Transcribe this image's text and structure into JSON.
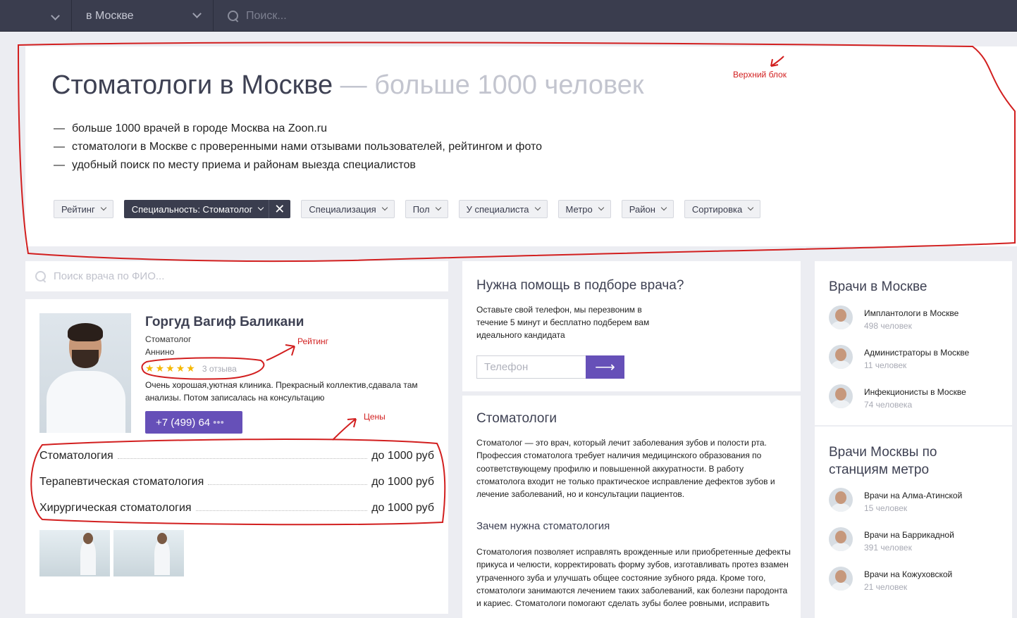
{
  "topnav": {
    "city": "в Москве",
    "search_placeholder": "Поиск..."
  },
  "topblock": {
    "title": "Стоматологи в Москве",
    "title_sub": " — больше 1000 человек",
    "bullets": [
      "больше 1000 врачей в городе Москва на Zoon.ru",
      "стоматологи в Москве с проверенными нами отзывами пользователей, рейтингом и фото",
      "удобный поиск по месту приема и районам выезда специалистов"
    ],
    "filters": [
      "Рейтинг",
      "Специальность: Стоматолог",
      "Специализация",
      "Пол",
      "У специалиста",
      "Метро",
      "Район",
      "Сортировка"
    ]
  },
  "doctor_search": {
    "placeholder": "Поиск врача по ФИО..."
  },
  "doctor": {
    "name": "Горгуд Вагиф Баликани",
    "specialty": "Стоматолог",
    "location": "Аннино",
    "rating_stars": 5,
    "reviews": "3 отзыва",
    "review_text": "Очень хорошая,уютная клиника. Прекрасный коллектив,сдавала там анализы. Потом записалась на консультацию",
    "phone": "+7 (499) 64",
    "phone_more": "•••",
    "prices": [
      {
        "service": "Стоматология",
        "price": "до 1000 руб"
      },
      {
        "service": "Терапевтическая стоматология",
        "price": "до 1000 руб"
      },
      {
        "service": "Хирургическая стоматология",
        "price": "до 1000 руб"
      }
    ]
  },
  "help": {
    "title": "Нужна помощь в подборе врача?",
    "text": "Оставьте свой телефон, мы перезвоним в течение 5 минут и бесплатно подберем вам идеального кандидата",
    "phone_placeholder": "Телефон",
    "submit_label": "⟶"
  },
  "about": {
    "title": "Стоматологи",
    "text": "Стоматолог — это врач, который лечит заболевания зубов и полости рта. Профессия стоматолога требует наличия медицинского образования по соответствующему профилю и повышенной аккуратности. В работу стоматолога входит не только практическое исправление дефектов зубов и лечение заболеваний, но и консультации пациентов.",
    "subtitle": "Зачем нужна стоматология",
    "text2": "Стоматология позволяет исправлять врожденные или приобретенные дефекты прикуса и челюсти, корректировать форму зубов, изготавливать протез взамен утраченного зуба и улучшать общее состояние зубного ряда. Кроме того, стоматологи занимаются лечением таких заболеваний, как болезни пародонта и кариес. Стоматологи помогают сделать зубы более ровными, исправить"
  },
  "doctors_moscow": {
    "title": "Врачи в Москве",
    "items": [
      {
        "label": "Имплантологи в Москве",
        "count": "498 человек"
      },
      {
        "label": "Администраторы в Москве",
        "count": "11 человек"
      },
      {
        "label": "Инфекционисты в Москве",
        "count": "74 человека"
      }
    ]
  },
  "doctors_metro": {
    "title": "Врачи Москвы по станциям метро",
    "items": [
      {
        "label": "Врачи на Алма-Атинской",
        "count": "15 человек"
      },
      {
        "label": "Врачи на Баррикадной",
        "count": "391 человек"
      },
      {
        "label": "Врачи на Кожуховской",
        "count": "21 человек"
      }
    ]
  },
  "annotations": {
    "top_block": "Верхний блок",
    "rating": "Рейтинг",
    "prices": "Цены"
  },
  "colors": {
    "nav_bg": "#3a3d4e",
    "accent": "#6650b8",
    "annotation": "#d21f1f",
    "star": "#f5b700"
  }
}
